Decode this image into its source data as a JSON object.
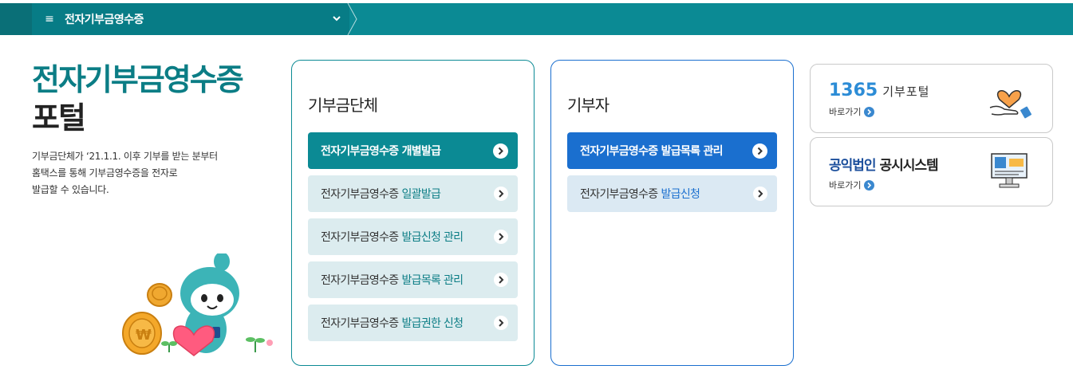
{
  "topbar": {
    "menu_icon": "hamburger-icon",
    "title": "전자기부금영수증",
    "dropdown_icon": "chevron-down-icon"
  },
  "intro": {
    "title_line1": "전자기부금영수증",
    "title_line2": "포털",
    "desc_line1": "기부금단체가 ‘21.1.1. 이후 기부를 받는 분부터",
    "desc_line2": "홈택스를 통해 기부금영수증을 전자로",
    "desc_line3": "발급할 수 있습니다."
  },
  "org_card": {
    "heading": "기부금단체",
    "buttons": [
      {
        "prefix": "전자기부금영수증 개별발급",
        "highlight": ""
      },
      {
        "prefix": "전자기부금영수증",
        "highlight": "일괄발급"
      },
      {
        "prefix": "전자기부금영수증",
        "highlight": "발급신청 관리"
      },
      {
        "prefix": "전자기부금영수증",
        "highlight": "발급목록 관리"
      },
      {
        "prefix": "전자기부금영수증",
        "highlight": "발급권한 신청"
      }
    ]
  },
  "donor_card": {
    "heading": "기부자",
    "buttons": [
      {
        "prefix": "전자기부금영수증 발급목록 관리",
        "highlight": ""
      },
      {
        "prefix": "전자기부금영수증",
        "highlight": "발급신청"
      }
    ]
  },
  "portals": [
    {
      "num": "1365",
      "word": "기부포털",
      "link": "바로가기",
      "icon": "heart-hand-icon"
    },
    {
      "name_part1": "공익법인",
      "name_part2": "공시시스템",
      "link": "바로가기",
      "icon": "computer-monitor-icon"
    }
  ],
  "colors": {
    "teal": "#0b8a94",
    "blue": "#1a6fcf",
    "teal_light": "#dcecef",
    "blue_light": "#dbe9f3"
  }
}
